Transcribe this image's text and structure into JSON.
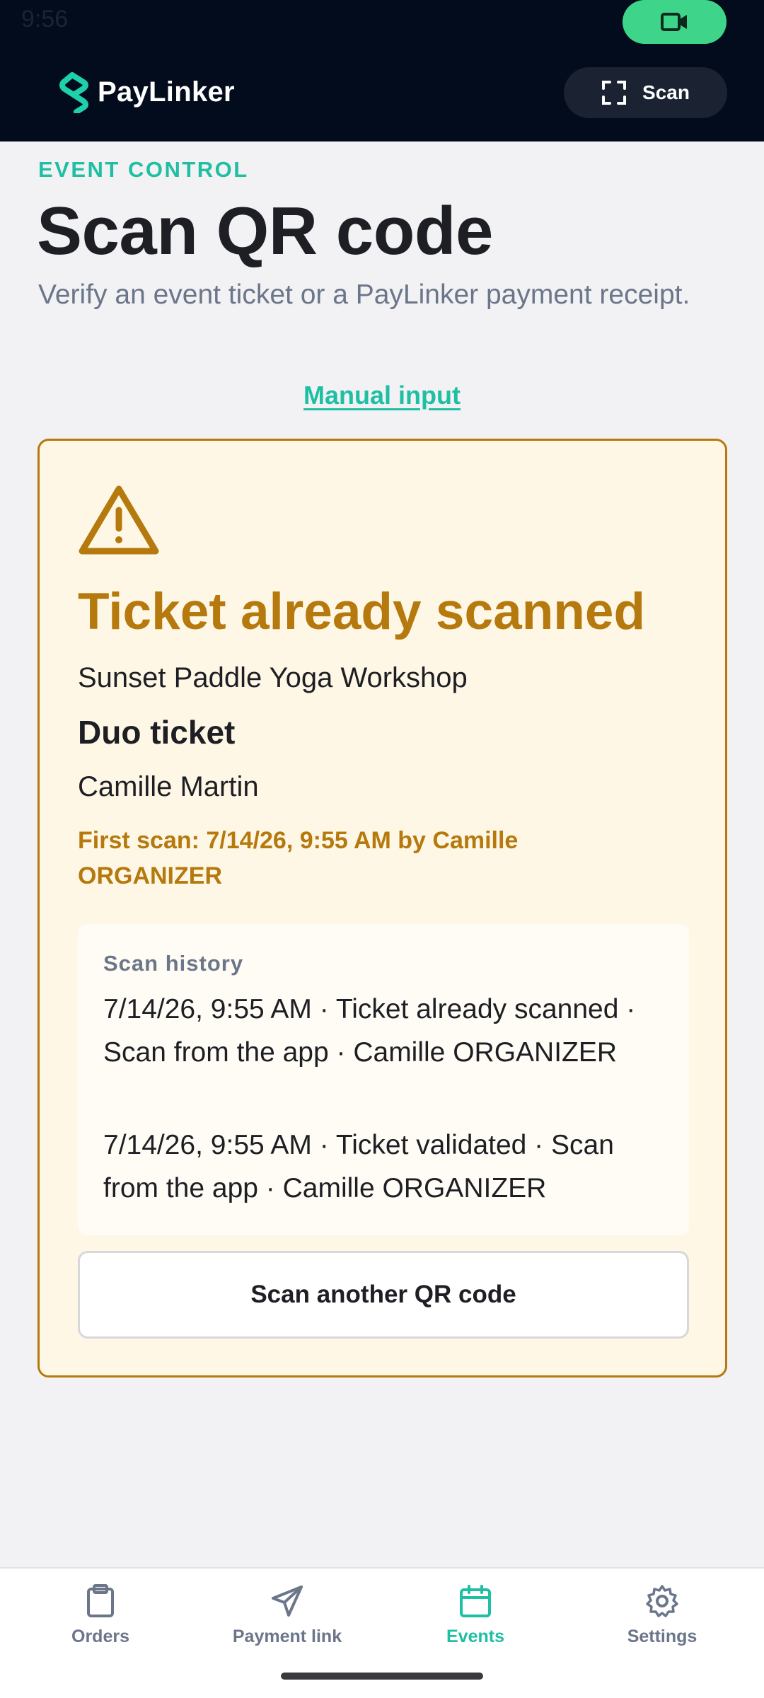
{
  "status_bar": {
    "time": "9:56"
  },
  "header": {
    "brand": "PayLinker",
    "scan_label": "Scan"
  },
  "page": {
    "eyebrow": "EVENT CONTROL",
    "title": "Scan QR code",
    "subtitle": "Verify an event ticket or a PayLinker payment receipt.",
    "manual_input": "Manual input"
  },
  "result": {
    "title": "Ticket already scanned",
    "event_name": "Sunset Paddle Yoga Workshop",
    "ticket_type": "Duo ticket",
    "holder": "Camille Martin",
    "first_scan": "First scan: 7/14/26, 9:55 AM by Camille ORGANIZER",
    "history_label": "Scan history",
    "history": [
      "7/14/26, 9:55 AM · Ticket already scanned · Scan from the app · Camille ORGANIZER",
      "7/14/26, 9:55 AM · Ticket validated · Scan from the app · Camille ORGANIZER"
    ],
    "scan_again": "Scan another QR code"
  },
  "nav": [
    {
      "label": "Orders",
      "icon": "clipboard-icon"
    },
    {
      "label": "Payment link",
      "icon": "send-icon"
    },
    {
      "label": "Events",
      "icon": "calendar-icon",
      "active": true
    },
    {
      "label": "Settings",
      "icon": "gear-icon"
    }
  ],
  "colors": {
    "header_bg": "#020c1c",
    "accent_teal": "#1fbfa3",
    "warning": "#b5790d",
    "warning_bg": "#fff7e6",
    "record_green": "#3ed58a"
  }
}
